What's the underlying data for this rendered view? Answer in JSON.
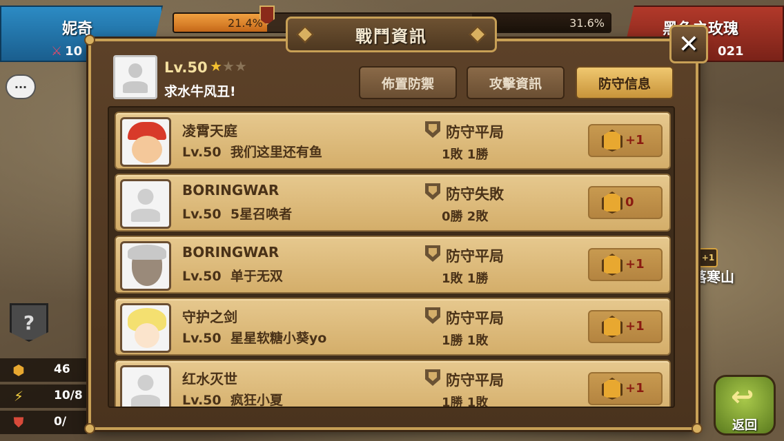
{
  "top_bar": {
    "left_team": {
      "name": "妮奇",
      "score": "10"
    },
    "right_team": {
      "name": "黑色之玫瑰",
      "score": "021"
    },
    "left_pct": "21.4%",
    "right_pct": "31.6%",
    "left_fraction": 0.214,
    "right_fraction": 0.316
  },
  "dialog": {
    "title": "戰鬥資訊",
    "close_label": "✕",
    "player": {
      "level": "Lv.50",
      "name": "求水牛风丑!",
      "stars_filled": 1,
      "stars_total": 3
    },
    "tabs": [
      {
        "label": "佈置防禦",
        "active": false
      },
      {
        "label": "攻擊資訊",
        "active": false
      },
      {
        "label": "防守信息",
        "active": true
      }
    ],
    "entries": [
      {
        "opponent": "凌霄天庭",
        "level": "Lv.50",
        "guild": "我们这里还有鱼",
        "result": "防守平局",
        "record": "1敗 1勝",
        "reward": "+1",
        "avatar": "cap-boy"
      },
      {
        "opponent": "BORINGWAR",
        "level": "Lv.50",
        "guild": "5星召唤者",
        "result": "防守失敗",
        "record": "0勝 2敗",
        "reward": "0",
        "avatar": "blank"
      },
      {
        "opponent": "BORINGWAR",
        "level": "Lv.50",
        "guild": "单于无双",
        "result": "防守平局",
        "record": "1敗 1勝",
        "reward": "+1",
        "avatar": "old-man"
      },
      {
        "opponent": "守护之剑",
        "level": "Lv.50",
        "guild": "星星软糖小葵yo",
        "result": "防守平局",
        "record": "1勝 1敗",
        "reward": "+1",
        "avatar": "elf"
      },
      {
        "opponent": "红水灭世",
        "level": "Lv.50",
        "guild": "疯狂小夏",
        "result": "防守平局",
        "record": "1勝 1敗",
        "reward": "+1",
        "avatar": "blank"
      }
    ]
  },
  "side": {
    "chat_label": "···",
    "help_label": "?",
    "resources": [
      {
        "icon": "medal-icon",
        "value": "46"
      },
      {
        "icon": "lightning-icon",
        "value": "10/8"
      },
      {
        "icon": "shield-flag-icon",
        "value": "0/"
      }
    ],
    "map_label": "落寒山",
    "map_badge": "+1",
    "back_label": "返回"
  }
}
